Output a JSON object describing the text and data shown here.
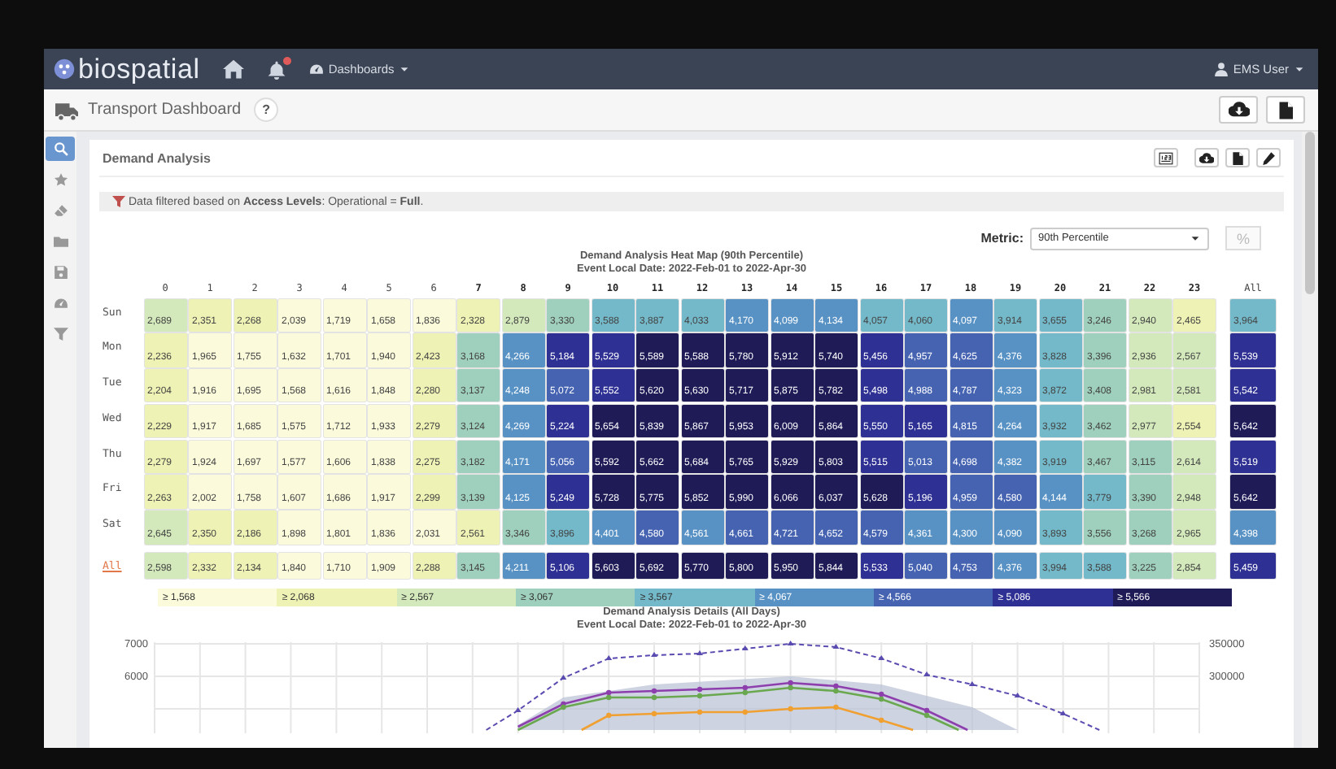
{
  "navbar": {
    "logo": "biospatial",
    "has_alert": true,
    "dashboards_menu": "Dashboards",
    "user_menu": "EMS User"
  },
  "subheader": {
    "title": "Transport Dashboard",
    "help": "?"
  },
  "sidebar": {
    "items": [
      {
        "selected": true
      },
      {
        "selected": false
      },
      {
        "selected": false
      },
      {
        "selected": false
      },
      {
        "selected": false
      },
      {
        "selected": false
      },
      {
        "selected": false
      }
    ]
  },
  "card": {
    "title": "Demand Analysis",
    "filter_note": "Data filtered based on **Access Levels**: Operational = **Full**.",
    "metric": {
      "label": "Metric:",
      "value": "90th Percentile",
      "percent_toggle": "%"
    },
    "heatmap": {
      "title": "Demand Analysis Heat Map (90th Percentile)",
      "subtitle": "Event Local Date: 2022-Feb-01 to 2022-Apr-30",
      "columns": [
        "0",
        "1",
        "2",
        "3",
        "4",
        "5",
        "6",
        "7",
        "8",
        "9",
        "10",
        "11",
        "12",
        "13",
        "14",
        "15",
        "16",
        "17",
        "18",
        "19",
        "20",
        "21",
        "22",
        "23"
      ],
      "total_column": "All",
      "rows": [
        {
          "label": "Sun",
          "kind": "day",
          "cells": [
            {
              "value": "2,689",
              "color": "#d3e9bb"
            },
            {
              "value": "2,351",
              "color": "#eef2b4"
            },
            {
              "value": "2,268",
              "color": "#eef2b4"
            },
            {
              "value": "2,039",
              "color": "#fbfbdc"
            },
            {
              "value": "1,719",
              "color": "#fbfbdc"
            },
            {
              "value": "1,658",
              "color": "#fbfbdc"
            },
            {
              "value": "1,836",
              "color": "#fbfbdc"
            },
            {
              "value": "2,328",
              "color": "#eef2b4"
            },
            {
              "value": "2,879",
              "color": "#d3e9bb"
            },
            {
              "value": "3,330",
              "color": "#9fd0bd"
            },
            {
              "value": "3,588",
              "color": "#74b9c9"
            },
            {
              "value": "3,887",
              "color": "#74b9c9"
            },
            {
              "value": "4,033",
              "color": "#74b9c9"
            },
            {
              "value": "4,170",
              "color": "#5892c5"
            },
            {
              "value": "4,099",
              "color": "#5892c5"
            },
            {
              "value": "4,134",
              "color": "#5892c5"
            },
            {
              "value": "4,057",
              "color": "#74b9c9"
            },
            {
              "value": "4,060",
              "color": "#74b9c9"
            },
            {
              "value": "4,097",
              "color": "#5892c5"
            },
            {
              "value": "3,914",
              "color": "#74b9c9"
            },
            {
              "value": "3,655",
              "color": "#74b9c9"
            },
            {
              "value": "3,246",
              "color": "#9fd0bd"
            },
            {
              "value": "2,940",
              "color": "#d3e9bb"
            },
            {
              "value": "2,465",
              "color": "#eef2b4"
            }
          ],
          "total": {
            "value": "3,964",
            "color": "#74b9c9"
          }
        },
        {
          "label": "Mon",
          "kind": "day",
          "cells": [
            {
              "value": "2,236",
              "color": "#eef2b4"
            },
            {
              "value": "1,965",
              "color": "#fbfbdc"
            },
            {
              "value": "1,755",
              "color": "#fbfbdc"
            },
            {
              "value": "1,632",
              "color": "#fbfbdc"
            },
            {
              "value": "1,701",
              "color": "#fbfbdc"
            },
            {
              "value": "1,940",
              "color": "#fbfbdc"
            },
            {
              "value": "2,423",
              "color": "#eef2b4"
            },
            {
              "value": "3,168",
              "color": "#9fd0bd"
            },
            {
              "value": "4,266",
              "color": "#5892c5"
            },
            {
              "value": "5,184",
              "color": "#2e3193"
            },
            {
              "value": "5,529",
              "color": "#2e3193"
            },
            {
              "value": "5,589",
              "color": "#1f1b57"
            },
            {
              "value": "5,588",
              "color": "#1f1b57"
            },
            {
              "value": "5,780",
              "color": "#1f1b57"
            },
            {
              "value": "5,912",
              "color": "#1f1b57"
            },
            {
              "value": "5,740",
              "color": "#1f1b57"
            },
            {
              "value": "5,456",
              "color": "#2e3193"
            },
            {
              "value": "4,957",
              "color": "#4563b1"
            },
            {
              "value": "4,625",
              "color": "#4563b1"
            },
            {
              "value": "4,376",
              "color": "#5892c5"
            },
            {
              "value": "3,828",
              "color": "#74b9c9"
            },
            {
              "value": "3,396",
              "color": "#9fd0bd"
            },
            {
              "value": "2,936",
              "color": "#d3e9bb"
            },
            {
              "value": "2,567",
              "color": "#d3e9bb"
            }
          ],
          "total": {
            "value": "5,539",
            "color": "#2e3193"
          }
        },
        {
          "label": "Tue",
          "kind": "day",
          "cells": [
            {
              "value": "2,204",
              "color": "#eef2b4"
            },
            {
              "value": "1,916",
              "color": "#fbfbdc"
            },
            {
              "value": "1,695",
              "color": "#fbfbdc"
            },
            {
              "value": "1,568",
              "color": "#fbfbdc"
            },
            {
              "value": "1,616",
              "color": "#fbfbdc"
            },
            {
              "value": "1,848",
              "color": "#fbfbdc"
            },
            {
              "value": "2,280",
              "color": "#eef2b4"
            },
            {
              "value": "3,137",
              "color": "#9fd0bd"
            },
            {
              "value": "4,248",
              "color": "#5892c5"
            },
            {
              "value": "5,072",
              "color": "#4563b1"
            },
            {
              "value": "5,552",
              "color": "#2e3193"
            },
            {
              "value": "5,620",
              "color": "#1f1b57"
            },
            {
              "value": "5,630",
              "color": "#1f1b57"
            },
            {
              "value": "5,717",
              "color": "#1f1b57"
            },
            {
              "value": "5,875",
              "color": "#1f1b57"
            },
            {
              "value": "5,782",
              "color": "#1f1b57"
            },
            {
              "value": "5,498",
              "color": "#2e3193"
            },
            {
              "value": "4,988",
              "color": "#4563b1"
            },
            {
              "value": "4,787",
              "color": "#4563b1"
            },
            {
              "value": "4,323",
              "color": "#5892c5"
            },
            {
              "value": "3,872",
              "color": "#74b9c9"
            },
            {
              "value": "3,408",
              "color": "#9fd0bd"
            },
            {
              "value": "2,981",
              "color": "#d3e9bb"
            },
            {
              "value": "2,581",
              "color": "#d3e9bb"
            }
          ],
          "total": {
            "value": "5,542",
            "color": "#2e3193"
          }
        },
        {
          "label": "Wed",
          "kind": "day",
          "cells": [
            {
              "value": "2,229",
              "color": "#eef2b4"
            },
            {
              "value": "1,917",
              "color": "#fbfbdc"
            },
            {
              "value": "1,685",
              "color": "#fbfbdc"
            },
            {
              "value": "1,575",
              "color": "#fbfbdc"
            },
            {
              "value": "1,712",
              "color": "#fbfbdc"
            },
            {
              "value": "1,933",
              "color": "#fbfbdc"
            },
            {
              "value": "2,279",
              "color": "#eef2b4"
            },
            {
              "value": "3,124",
              "color": "#9fd0bd"
            },
            {
              "value": "4,269",
              "color": "#5892c5"
            },
            {
              "value": "5,224",
              "color": "#2e3193"
            },
            {
              "value": "5,654",
              "color": "#1f1b57"
            },
            {
              "value": "5,839",
              "color": "#1f1b57"
            },
            {
              "value": "5,867",
              "color": "#1f1b57"
            },
            {
              "value": "5,953",
              "color": "#1f1b57"
            },
            {
              "value": "6,009",
              "color": "#1f1b57"
            },
            {
              "value": "5,864",
              "color": "#1f1b57"
            },
            {
              "value": "5,550",
              "color": "#2e3193"
            },
            {
              "value": "5,165",
              "color": "#2e3193"
            },
            {
              "value": "4,815",
              "color": "#4563b1"
            },
            {
              "value": "4,264",
              "color": "#5892c5"
            },
            {
              "value": "3,932",
              "color": "#74b9c9"
            },
            {
              "value": "3,462",
              "color": "#9fd0bd"
            },
            {
              "value": "2,977",
              "color": "#d3e9bb"
            },
            {
              "value": "2,554",
              "color": "#eef2b4"
            }
          ],
          "total": {
            "value": "5,642",
            "color": "#1f1b57"
          }
        },
        {
          "label": "Thu",
          "kind": "day",
          "cells": [
            {
              "value": "2,279",
              "color": "#eef2b4"
            },
            {
              "value": "1,924",
              "color": "#fbfbdc"
            },
            {
              "value": "1,697",
              "color": "#fbfbdc"
            },
            {
              "value": "1,577",
              "color": "#fbfbdc"
            },
            {
              "value": "1,606",
              "color": "#fbfbdc"
            },
            {
              "value": "1,838",
              "color": "#fbfbdc"
            },
            {
              "value": "2,275",
              "color": "#eef2b4"
            },
            {
              "value": "3,182",
              "color": "#9fd0bd"
            },
            {
              "value": "4,171",
              "color": "#5892c5"
            },
            {
              "value": "5,056",
              "color": "#4563b1"
            },
            {
              "value": "5,592",
              "color": "#1f1b57"
            },
            {
              "value": "5,662",
              "color": "#1f1b57"
            },
            {
              "value": "5,684",
              "color": "#1f1b57"
            },
            {
              "value": "5,765",
              "color": "#1f1b57"
            },
            {
              "value": "5,929",
              "color": "#1f1b57"
            },
            {
              "value": "5,803",
              "color": "#1f1b57"
            },
            {
              "value": "5,515",
              "color": "#2e3193"
            },
            {
              "value": "5,013",
              "color": "#4563b1"
            },
            {
              "value": "4,698",
              "color": "#4563b1"
            },
            {
              "value": "4,382",
              "color": "#5892c5"
            },
            {
              "value": "3,919",
              "color": "#74b9c9"
            },
            {
              "value": "3,467",
              "color": "#9fd0bd"
            },
            {
              "value": "3,115",
              "color": "#9fd0bd"
            },
            {
              "value": "2,614",
              "color": "#d3e9bb"
            }
          ],
          "total": {
            "value": "5,519",
            "color": "#2e3193"
          }
        },
        {
          "label": "Fri",
          "kind": "day",
          "cells": [
            {
              "value": "2,263",
              "color": "#eef2b4"
            },
            {
              "value": "2,002",
              "color": "#fbfbdc"
            },
            {
              "value": "1,758",
              "color": "#fbfbdc"
            },
            {
              "value": "1,607",
              "color": "#fbfbdc"
            },
            {
              "value": "1,686",
              "color": "#fbfbdc"
            },
            {
              "value": "1,917",
              "color": "#fbfbdc"
            },
            {
              "value": "2,299",
              "color": "#eef2b4"
            },
            {
              "value": "3,139",
              "color": "#9fd0bd"
            },
            {
              "value": "4,125",
              "color": "#5892c5"
            },
            {
              "value": "5,249",
              "color": "#2e3193"
            },
            {
              "value": "5,728",
              "color": "#1f1b57"
            },
            {
              "value": "5,775",
              "color": "#1f1b57"
            },
            {
              "value": "5,852",
              "color": "#1f1b57"
            },
            {
              "value": "5,990",
              "color": "#1f1b57"
            },
            {
              "value": "6,066",
              "color": "#1f1b57"
            },
            {
              "value": "6,037",
              "color": "#1f1b57"
            },
            {
              "value": "5,628",
              "color": "#1f1b57"
            },
            {
              "value": "5,196",
              "color": "#2e3193"
            },
            {
              "value": "4,959",
              "color": "#4563b1"
            },
            {
              "value": "4,580",
              "color": "#4563b1"
            },
            {
              "value": "4,144",
              "color": "#5892c5"
            },
            {
              "value": "3,779",
              "color": "#74b9c9"
            },
            {
              "value": "3,390",
              "color": "#9fd0bd"
            },
            {
              "value": "2,948",
              "color": "#d3e9bb"
            }
          ],
          "total": {
            "value": "5,642",
            "color": "#1f1b57"
          }
        },
        {
          "label": "Sat",
          "kind": "day",
          "cells": [
            {
              "value": "2,645",
              "color": "#d3e9bb"
            },
            {
              "value": "2,350",
              "color": "#eef2b4"
            },
            {
              "value": "2,186",
              "color": "#eef2b4"
            },
            {
              "value": "1,898",
              "color": "#fbfbdc"
            },
            {
              "value": "1,801",
              "color": "#fbfbdc"
            },
            {
              "value": "1,836",
              "color": "#fbfbdc"
            },
            {
              "value": "2,031",
              "color": "#fbfbdc"
            },
            {
              "value": "2,561",
              "color": "#eef2b4"
            },
            {
              "value": "3,346",
              "color": "#9fd0bd"
            },
            {
              "value": "3,896",
              "color": "#74b9c9"
            },
            {
              "value": "4,401",
              "color": "#5892c5"
            },
            {
              "value": "4,580",
              "color": "#4563b1"
            },
            {
              "value": "4,561",
              "color": "#5892c5"
            },
            {
              "value": "4,661",
              "color": "#4563b1"
            },
            {
              "value": "4,721",
              "color": "#4563b1"
            },
            {
              "value": "4,652",
              "color": "#4563b1"
            },
            {
              "value": "4,579",
              "color": "#4563b1"
            },
            {
              "value": "4,361",
              "color": "#5892c5"
            },
            {
              "value": "4,300",
              "color": "#5892c5"
            },
            {
              "value": "4,090",
              "color": "#5892c5"
            },
            {
              "value": "3,893",
              "color": "#74b9c9"
            },
            {
              "value": "3,556",
              "color": "#9fd0bd"
            },
            {
              "value": "3,268",
              "color": "#9fd0bd"
            },
            {
              "value": "2,965",
              "color": "#d3e9bb"
            }
          ],
          "total": {
            "value": "4,398",
            "color": "#5892c5"
          }
        },
        {
          "label": "All",
          "kind": "total",
          "cells": [
            {
              "value": "2,598",
              "color": "#d3e9bb"
            },
            {
              "value": "2,332",
              "color": "#eef2b4"
            },
            {
              "value": "2,134",
              "color": "#eef2b4"
            },
            {
              "value": "1,840",
              "color": "#fbfbdc"
            },
            {
              "value": "1,710",
              "color": "#fbfbdc"
            },
            {
              "value": "1,909",
              "color": "#fbfbdc"
            },
            {
              "value": "2,288",
              "color": "#eef2b4"
            },
            {
              "value": "3,145",
              "color": "#9fd0bd"
            },
            {
              "value": "4,211",
              "color": "#5892c5"
            },
            {
              "value": "5,106",
              "color": "#2e3193"
            },
            {
              "value": "5,603",
              "color": "#1f1b57"
            },
            {
              "value": "5,692",
              "color": "#1f1b57"
            },
            {
              "value": "5,770",
              "color": "#1f1b57"
            },
            {
              "value": "5,800",
              "color": "#1f1b57"
            },
            {
              "value": "5,950",
              "color": "#1f1b57"
            },
            {
              "value": "5,844",
              "color": "#1f1b57"
            },
            {
              "value": "5,533",
              "color": "#2e3193"
            },
            {
              "value": "5,040",
              "color": "#4563b1"
            },
            {
              "value": "4,753",
              "color": "#4563b1"
            },
            {
              "value": "4,376",
              "color": "#5892c5"
            },
            {
              "value": "3,994",
              "color": "#74b9c9"
            },
            {
              "value": "3,588",
              "color": "#74b9c9"
            },
            {
              "value": "3,225",
              "color": "#9fd0bd"
            },
            {
              "value": "2,854",
              "color": "#d3e9bb"
            }
          ],
          "total": {
            "value": "5,459",
            "color": "#2e3193"
          }
        }
      ],
      "legend": [
        {
          "label": "≥ 1,568",
          "color": "#fbfbdc"
        },
        {
          "label": "≥ 2,068",
          "color": "#eef2b4"
        },
        {
          "label": "≥ 2,567",
          "color": "#d3e9bb"
        },
        {
          "label": "≥ 3,067",
          "color": "#9fd0bd"
        },
        {
          "label": "≥ 3,567",
          "color": "#74b9c9"
        },
        {
          "label": "≥ 4,067",
          "color": "#5892c5"
        },
        {
          "label": "≥ 4,566",
          "color": "#4563b1"
        },
        {
          "label": "≥ 5,086",
          "color": "#2e3193"
        },
        {
          "label": "≥ 5,566",
          "color": "#1f1b57"
        }
      ]
    },
    "details_chart": {
      "title": "Demand Analysis Details (All Days)",
      "subtitle": "Event Local Date: 2022-Feb-01 to 2022-Apr-30",
      "left_ticks": [
        "7000",
        "6000"
      ],
      "right_ticks": [
        "350000",
        "300000"
      ]
    }
  }
}
